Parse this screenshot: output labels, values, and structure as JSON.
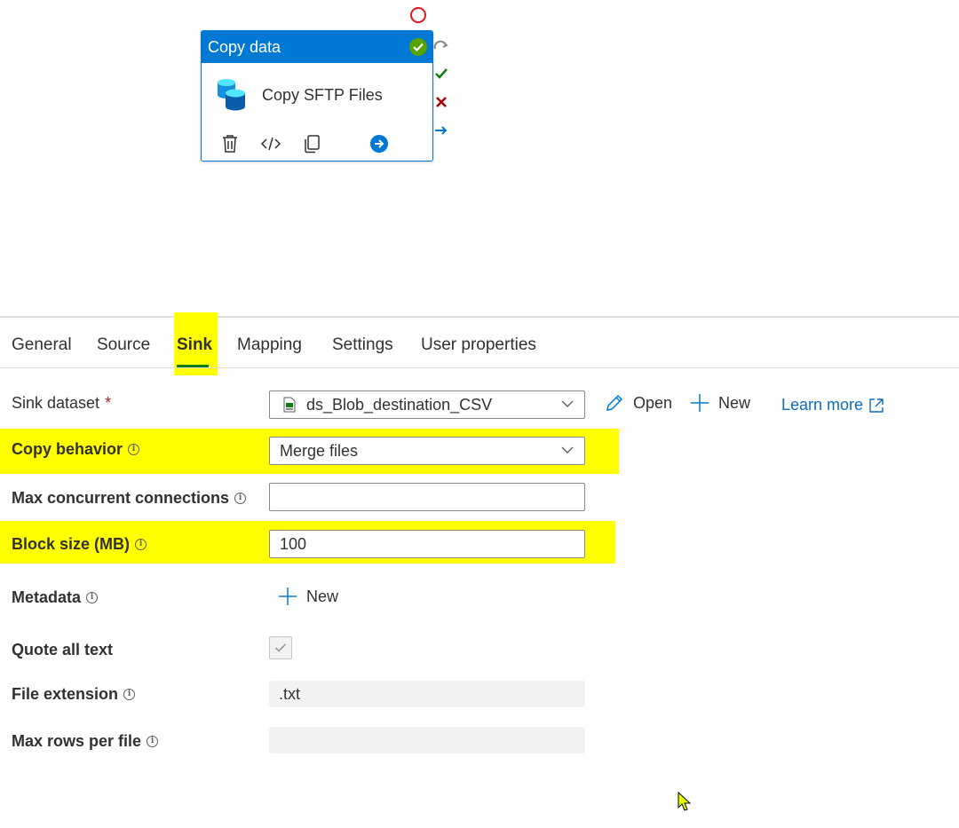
{
  "activity": {
    "type_title": "Copy data",
    "name": "Copy SFTP Files",
    "icons": [
      "database-icon",
      "success-check-icon",
      "delete-icon",
      "code-icon",
      "clone-icon",
      "arrow-right-circle-icon"
    ],
    "side_handles": [
      "skip-icon",
      "on-success-icon",
      "on-failure-icon",
      "on-completion-icon"
    ]
  },
  "tabs": [
    {
      "label": "General"
    },
    {
      "label": "Source"
    },
    {
      "label": "Sink",
      "active": true
    },
    {
      "label": "Mapping"
    },
    {
      "label": "Settings"
    },
    {
      "label": "User properties"
    }
  ],
  "form": {
    "sink_dataset": {
      "label": "Sink dataset",
      "required_mark": "*",
      "value": "ds_Blob_destination_CSV",
      "open_label": "Open",
      "new_label": "New",
      "learn_more_label": "Learn more"
    },
    "copy_behavior": {
      "label": "Copy behavior",
      "value": "Merge files"
    },
    "max_concurrent_connections": {
      "label": "Max concurrent connections",
      "value": ""
    },
    "block_size": {
      "label": "Block size (MB)",
      "value": "100"
    },
    "metadata": {
      "label": "Metadata",
      "new_label": "New"
    },
    "quote_all_text": {
      "label": "Quote all text",
      "checked": true
    },
    "file_extension": {
      "label": "File extension",
      "value": ".txt"
    },
    "max_rows_per_file": {
      "label": "Max rows per file",
      "value": ""
    }
  },
  "colors": {
    "accent": "#0078d4",
    "highlight": "#ffff00",
    "success": "#57a300",
    "failure": "#a80000",
    "active_tab_underline": "#107c10"
  }
}
